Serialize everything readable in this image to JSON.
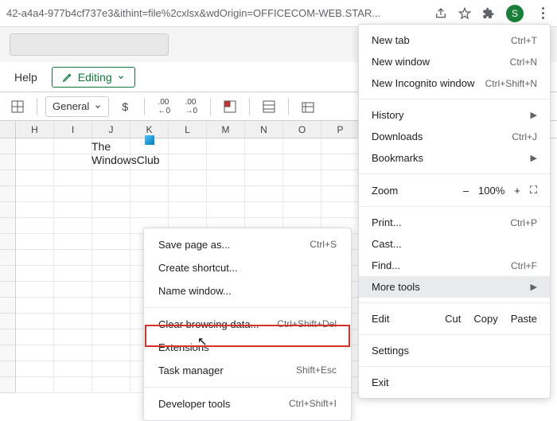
{
  "browser": {
    "url_fragment": "42-a4a4-977b4cf737e3&ithint=file%2cxlsx&wdOrigin=OFFICECOM-WEB.STAR...",
    "avatar_letter": "S"
  },
  "toolbar": {
    "help": "Help",
    "editing": "Editing",
    "numfmt": "General"
  },
  "columns": [
    "H",
    "I",
    "J",
    "K",
    "L",
    "M",
    "N",
    "O",
    "P"
  ],
  "logo": {
    "line1": "The",
    "line2": "WindowsClub"
  },
  "chrome_menu": {
    "new_tab": "New tab",
    "new_tab_sc": "Ctrl+T",
    "new_window": "New window",
    "new_window_sc": "Ctrl+N",
    "new_incognito": "New Incognito window",
    "new_incognito_sc": "Ctrl+Shift+N",
    "history": "History",
    "downloads": "Downloads",
    "downloads_sc": "Ctrl+J",
    "bookmarks": "Bookmarks",
    "zoom": "Zoom",
    "zoom_minus": "–",
    "zoom_val": "100%",
    "zoom_plus": "+",
    "print": "Print...",
    "print_sc": "Ctrl+P",
    "cast": "Cast...",
    "find": "Find...",
    "find_sc": "Ctrl+F",
    "more_tools": "More tools",
    "edit": "Edit",
    "cut": "Cut",
    "copy": "Copy",
    "paste": "Paste",
    "settings": "Settings",
    "exit": "Exit"
  },
  "submenu": {
    "save_page": "Save page as...",
    "save_page_sc": "Ctrl+S",
    "create_shortcut": "Create shortcut...",
    "name_window": "Name window...",
    "clear_data": "Clear browsing data...",
    "clear_data_sc": "Ctrl+Shift+Del",
    "extensions": "Extensions",
    "task_manager": "Task manager",
    "task_manager_sc": "Shift+Esc",
    "developer_tools": "Developer tools",
    "developer_tools_sc": "Ctrl+Shift+I"
  }
}
